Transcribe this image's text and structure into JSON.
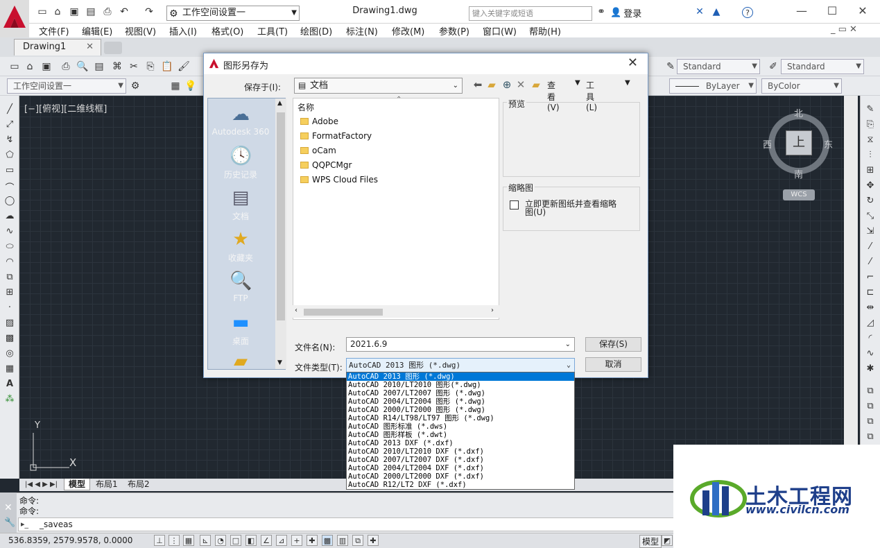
{
  "window": {
    "title": "Drawing1.dwg",
    "search_placeholder": "键入关键字或短语",
    "login": "登录"
  },
  "quick_access": {
    "workspace": "工作空间设置一"
  },
  "menu": [
    "文件(F)",
    "编辑(E)",
    "视图(V)",
    "插入(I)",
    "格式(O)",
    "工具(T)",
    "绘图(D)",
    "标注(N)",
    "修改(M)",
    "参数(P)",
    "窗口(W)",
    "帮助(H)"
  ],
  "doc_tab": {
    "label": "Drawing1"
  },
  "toolbar": {
    "workspace2": "工作空间设置一",
    "textstyle": "Standard",
    "dimstyle": "Standard",
    "linetype": "ByLayer",
    "color": "ByColor"
  },
  "viewport": {
    "label": "[−][俯视][二维线框]"
  },
  "viewcube": {
    "north": "北",
    "south": "南",
    "east": "东",
    "west": "西",
    "face": "上",
    "wcs": "WCS"
  },
  "ucs": {
    "x": "X",
    "y": "Y"
  },
  "layout_tabs": [
    "模型",
    "布局1",
    "布局2"
  ],
  "command": {
    "line1": "命令:",
    "line2": "命令:",
    "input": "_saveas"
  },
  "status": {
    "coords": "536.8359,   2579.9578, 0.0000",
    "model": "模型"
  },
  "dialog": {
    "title": "图形另存为",
    "save_in_label": "保存于(I):",
    "save_in_value": "文档",
    "view_menu": "查看(V)",
    "tools_menu": "工具(L)",
    "places": [
      "Autodesk 360",
      "历史记录",
      "文档",
      "收藏夹",
      "FTP",
      "桌面"
    ],
    "list_header": "名称",
    "files": [
      "Adobe",
      "FormatFactory",
      "oCam",
      "QQPCMgr",
      "WPS Cloud Files"
    ],
    "preview_label": "预览",
    "thumbnail_label": "缩略图",
    "thumbnail_option": "立即更新图纸并查看缩略图(U)",
    "filename_label": "文件名(N):",
    "filename_value": "2021.6.9",
    "filetype_label": "文件类型(T):",
    "filetype_value": "AutoCAD 2013 图形 (*.dwg)",
    "save_button": "保存(S)",
    "cancel_button": "取消",
    "filetype_options": [
      "AutoCAD 2013 图形 (*.dwg)",
      "AutoCAD 2010/LT2010 图形(*.dwg)",
      "AutoCAD 2007/LT2007 图形 (*.dwg)",
      "AutoCAD 2004/LT2004 图形 (*.dwg)",
      "AutoCAD 2000/LT2000 图形 (*.dwg)",
      "AutoCAD R14/LT98/LT97 图形 (*.dwg)",
      "AutoCAD 图形标准 (*.dws)",
      "AutoCAD 图形样板 (*.dwt)",
      "AutoCAD 2013 DXF (*.dxf)",
      "AutoCAD 2010/LT2010 DXF (*.dxf)",
      "AutoCAD 2007/LT2007 DXF (*.dxf)",
      "AutoCAD 2004/LT2004 DXF (*.dxf)",
      "AutoCAD 2000/LT2000 DXF (*.dxf)",
      "AutoCAD R12/LT2 DXF (*.dxf)"
    ],
    "selected_option_index": 0
  },
  "watermark": {
    "name": "土木工程网",
    "url": "www.civilcn.com"
  },
  "colors": {
    "canvas": "#212830",
    "selection": "#0078d7",
    "brand_red": "#c8102e",
    "watermark_blue": "#1e3f8a"
  }
}
